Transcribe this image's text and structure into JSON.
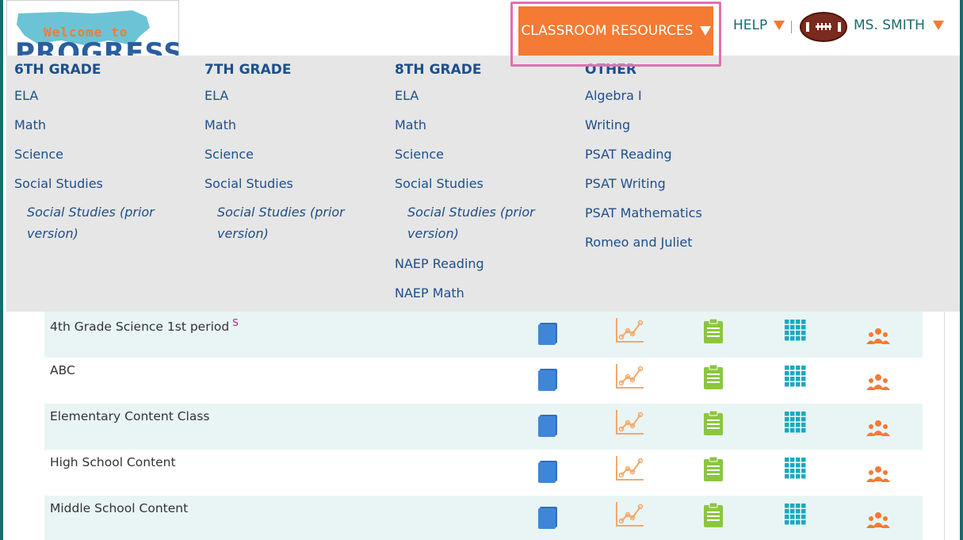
{
  "logo": {
    "line1": "Welcome to",
    "line2": "PROGRESS"
  },
  "topnav": {
    "classroom_resources": "CLASSROOM RESOURCES",
    "help": "HELP",
    "user": "MS. SMITH"
  },
  "colors": {
    "accent_orange": "#f57a33",
    "teal": "#1a6b6b",
    "link_blue": "#1d4f8a",
    "highlight_outline": "#e070b0",
    "row_alt": "#e9f5f5"
  },
  "menu": {
    "col6": {
      "title": "6TH GRADE",
      "items": [
        "ELA",
        "Math",
        "Science",
        "Social Studies"
      ],
      "sub": "Social Studies (prior version)"
    },
    "col7": {
      "title": "7TH GRADE",
      "items": [
        "ELA",
        "Math",
        "Science",
        "Social Studies"
      ],
      "sub": "Social Studies (prior version)"
    },
    "col8": {
      "title": "8TH GRADE",
      "items": [
        "ELA",
        "Math",
        "Science",
        "Social Studies"
      ],
      "sub": "Social Studies (prior version)",
      "extra": [
        "NAEP Reading",
        "NAEP Math"
      ]
    },
    "other": {
      "title": "OTHER",
      "items": [
        "Algebra I",
        "Writing",
        "PSAT Reading",
        "PSAT Writing",
        "PSAT Mathematics",
        "Romeo and Juliet"
      ]
    }
  },
  "classes": [
    {
      "name": "4th Grade Science 1st period",
      "badge": "S"
    },
    {
      "name": "ABC"
    },
    {
      "name": "Elementary Content Class"
    },
    {
      "name": "High School Content"
    },
    {
      "name": "Middle School Content"
    }
  ],
  "row_icons": [
    "book-icon",
    "chart-icon",
    "clipboard-icon",
    "grid-icon",
    "people-icon"
  ]
}
